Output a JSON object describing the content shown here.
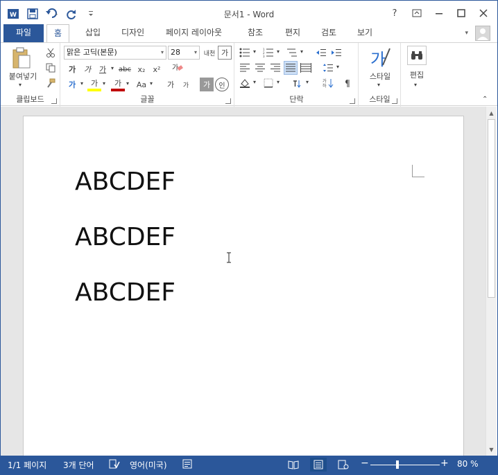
{
  "app": {
    "title": "문서1 - Word"
  },
  "window_controls": {
    "help": "?",
    "restore_ribbon": "▣",
    "minimize": "—",
    "maximize": "☐",
    "close": "✕"
  },
  "tabs": [
    {
      "label": "파일"
    },
    {
      "label": "홈"
    },
    {
      "label": "삽입"
    },
    {
      "label": "디자인"
    },
    {
      "label": "페이지 레이아웃"
    },
    {
      "label": "참조"
    },
    {
      "label": "편지"
    },
    {
      "label": "검토"
    },
    {
      "label": "보기"
    }
  ],
  "ribbon": {
    "clipboard": {
      "label": "클립보드",
      "paste_label": "붙여넣기"
    },
    "font": {
      "label": "글꼴",
      "font_name": "맑은 고딕(본문)",
      "font_size": "28",
      "grow_label": "가",
      "shrink_label": "가",
      "bold": "가",
      "italic": "가",
      "underline": "가",
      "strike": "abc",
      "subscript": "x₂",
      "superscript": "x²",
      "clear_format": "가",
      "text_effect": "가",
      "highlight": "가",
      "font_color": "가",
      "change_case": "Aa",
      "phonetic": "가",
      "char_border": "가",
      "char_shading": "가",
      "enclose": "인",
      "caps_label": "내천"
    },
    "paragraph": {
      "label": "단락"
    },
    "styles": {
      "label": "스타일",
      "button_label": "스타일",
      "icon_glyph": "가"
    },
    "editing": {
      "label": "편집"
    }
  },
  "document": {
    "lines": [
      "ABCDEF",
      "ABCDEF",
      "ABCDEF"
    ]
  },
  "status": {
    "page": "1/1 페이지",
    "words": "3개 단어",
    "language": "영어(미국)",
    "zoom": "80 %",
    "zoom_value": 80
  },
  "colors": {
    "brand": "#2b579a",
    "highlight": "#ffff00",
    "font_color": "#c00000"
  }
}
